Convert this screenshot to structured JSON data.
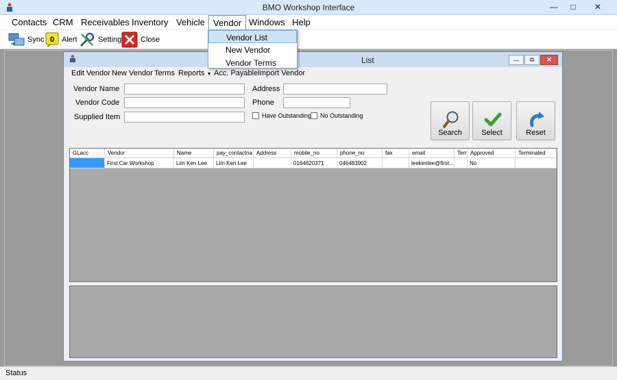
{
  "window": {
    "title": "BMO Workshop Interface"
  },
  "menu": {
    "contacts": "Contacts",
    "crm": "CRM",
    "receivables": "Receivables",
    "inventory": "Inventory",
    "vehicle": "Vehicle",
    "vendor": "Vendor",
    "windows": "Windows",
    "help": "Help"
  },
  "toolbar": {
    "sync": "Sync",
    "alert_count": "0",
    "alert": "Alert",
    "setting": "Setting",
    "close": "Close"
  },
  "vendor_menu": {
    "items": [
      "Vendor List",
      "New Vendor",
      "Vendor Terms"
    ]
  },
  "child": {
    "title_visible": "List",
    "menu": [
      "Edit Vendor",
      "New Vendor",
      "Terms",
      "Reports",
      "Acc. Payable",
      "Import Vendor"
    ],
    "fields": {
      "vendor_name": "Vendor Name",
      "vendor_code": "Vendor Code",
      "supplied_item": "Supplied Item",
      "address": "Address",
      "phone": "Phone",
      "have_outstanding": "Have Outstanding",
      "no_outstanding": "No Outstanding"
    },
    "buttons": {
      "search": "Search",
      "select": "Select",
      "reset": "Reset"
    },
    "grid": {
      "headers": [
        "GLacc",
        "Vendor",
        "Name",
        "pay_contactna",
        "Address",
        "mobile_no",
        "phone_no",
        "fax",
        "email",
        "Terr",
        "Approved",
        "Terminated"
      ],
      "rows": [
        [
          "",
          "First Car Workshop",
          "Lim Ken Lee",
          "Lim Ken Lee",
          "",
          "0164820371",
          "046483902",
          "",
          "leekenlee@first...",
          "",
          "No",
          ""
        ]
      ]
    }
  },
  "status": {
    "text": "Status"
  }
}
